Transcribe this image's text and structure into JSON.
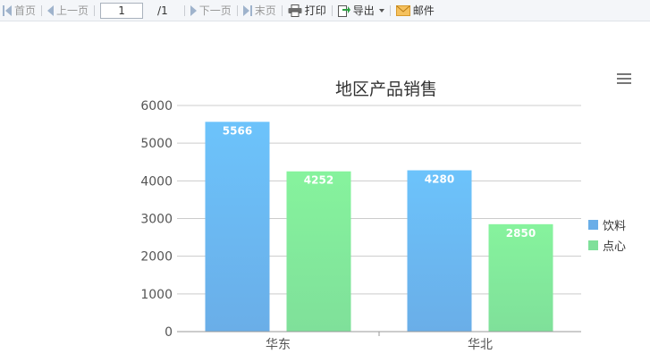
{
  "toolbar": {
    "first": "首页",
    "prev": "上一页",
    "page_value": "1",
    "page_total": "/1",
    "next": "下一页",
    "last": "末页",
    "print": "打印",
    "export": "导出",
    "mail": "邮件"
  },
  "colors": {
    "series_1": "#6aaee8",
    "series_2": "#7fe09a",
    "grid": "#cccccc",
    "axis_text": "#555555",
    "title": "#333333"
  },
  "chart_data": {
    "type": "bar",
    "title": "地区产品销售",
    "categories": [
      "华东",
      "华北"
    ],
    "series": [
      {
        "name": "饮料",
        "values": [
          5566,
          4280
        ]
      },
      {
        "name": "点心",
        "values": [
          4252,
          2850
        ]
      }
    ],
    "ylim": [
      0,
      6000
    ],
    "yticks": [
      0,
      1000,
      2000,
      3000,
      4000,
      5000,
      6000
    ],
    "grid": true,
    "legend_position": "right",
    "data_labels": true
  }
}
